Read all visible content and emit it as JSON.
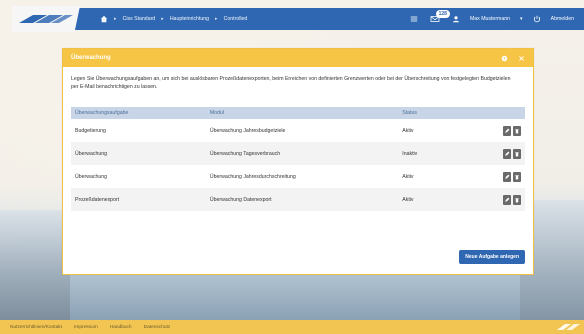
{
  "colors": {
    "topbar": "#2f67b2",
    "panel_header": "#f6c546",
    "table_header": "#c8d5e7",
    "footer": "#f2c553",
    "primary_button": "#2f67b2"
  },
  "topbar": {
    "breadcrumb": [
      "Ciss Standard",
      "Haupteinrichtung",
      "Controlled"
    ],
    "notifications_count": "128",
    "user_label": "Max Mustermann",
    "logout_label": "Abmelden"
  },
  "panel": {
    "title": "Überwachung",
    "intro": "Legen Sie Überwachungsaufgaben an, um sich bei auslösbaren Prozeßdatenexporten, beim Erreichen von definierten Grenzwerten oder bei der Überschreitung von festgelegten Budgetzielen per E-Mail benachrichtigen zu lassen.",
    "table": {
      "headers": [
        "Überwachungsaufgabe",
        "Modul",
        "Status"
      ],
      "rows": [
        {
          "task": "Budgetierung",
          "module": "Überwachung Jahresbudgetziele",
          "status": "Aktiv"
        },
        {
          "task": "Überwachung",
          "module": "Überwachung Tagesverbrauch",
          "status": "Inaktiv"
        },
        {
          "task": "Überwachung",
          "module": "Überwachung Jahresdurchschreitung",
          "status": "Aktiv"
        },
        {
          "task": "Prozeßdatenexport",
          "module": "Überwachung Datenexport",
          "status": "Aktiv"
        }
      ]
    },
    "new_task_button": "Neue Aufgabe anlegen"
  },
  "footer": {
    "links": [
      "Nutzerrichtlinien/Kontakt",
      "Impressum",
      "Handbuch",
      "Datenschutz"
    ]
  },
  "icons": {
    "home": "home-icon",
    "menu": "hamburger-icon",
    "envelope": "envelope-icon",
    "user": "user-icon",
    "logout": "power-icon",
    "help": "help-icon",
    "close": "close-icon",
    "edit": "pencil-icon",
    "delete": "trash-icon"
  }
}
